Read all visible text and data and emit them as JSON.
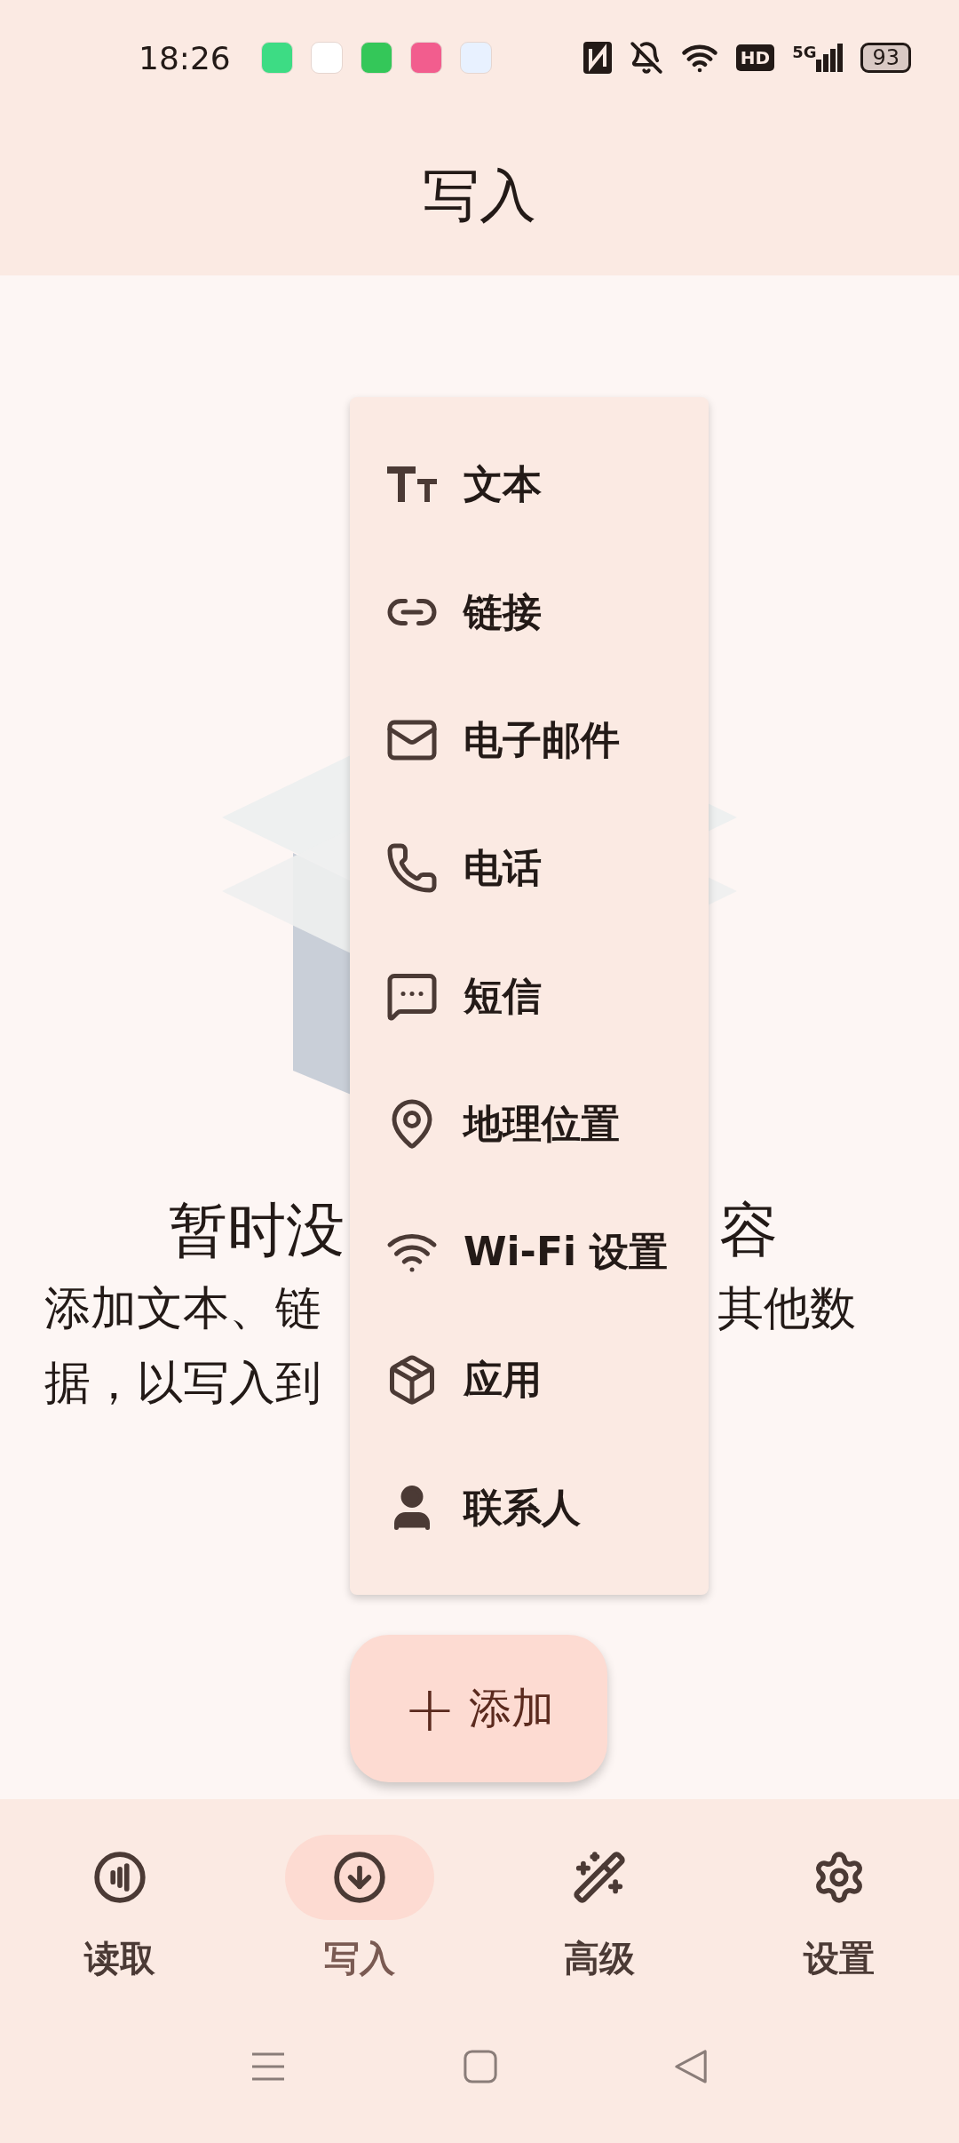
{
  "status_bar": {
    "time": "18:26",
    "apps": [
      {
        "color": "#3ddc84"
      },
      {
        "color": "#ffffff"
      },
      {
        "color": "#34c759"
      },
      {
        "color": "#f25d8e"
      },
      {
        "color": "#e8f1ff"
      }
    ],
    "hd": "HD",
    "network": "5G",
    "battery": "93"
  },
  "header": {
    "title": "写入"
  },
  "empty_state": {
    "title_left": "暂时没",
    "title_right": "容",
    "description_line1_left": "添加文本、链",
    "description_line1_right": "其他数",
    "description_line2": "据，以写入到"
  },
  "menu": {
    "items": [
      {
        "kind": "text",
        "label": "文本"
      },
      {
        "kind": "link",
        "label": "链接"
      },
      {
        "kind": "email",
        "label": "电子邮件"
      },
      {
        "kind": "phone",
        "label": "电话"
      },
      {
        "kind": "sms",
        "label": "短信"
      },
      {
        "kind": "location",
        "label": "地理位置"
      },
      {
        "kind": "wifi",
        "label": "Wi-Fi 设置"
      },
      {
        "kind": "app",
        "label": "应用"
      },
      {
        "kind": "contact",
        "label": "联系人"
      }
    ]
  },
  "fab": {
    "icon": "+",
    "label": "添加"
  },
  "bottom_nav": [
    {
      "kind": "read",
      "label": "读取",
      "selected": false
    },
    {
      "kind": "write",
      "label": "写入",
      "selected": true
    },
    {
      "kind": "advanced",
      "label": "高级",
      "selected": false
    },
    {
      "kind": "settings",
      "label": "设置",
      "selected": false
    }
  ]
}
